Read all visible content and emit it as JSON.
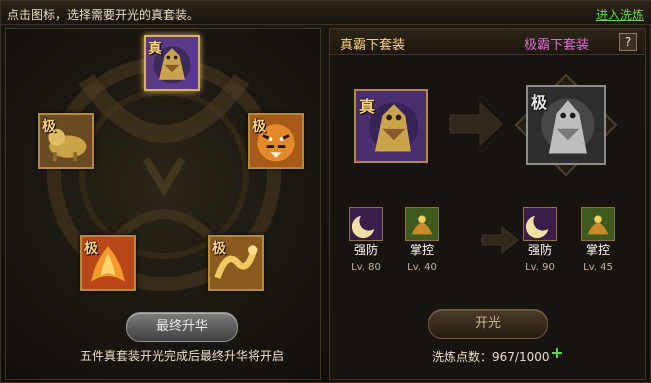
{
  "topbar": {
    "tip": "点击图标，选择需要开光的真套装。",
    "link": "进入洗炼"
  },
  "left_panel": {
    "slots": [
      {
        "badge": "真",
        "icon": "dragon-beast-icon",
        "selected": true
      },
      {
        "badge": "极",
        "icon": "qilin-icon",
        "selected": false
      },
      {
        "badge": "极",
        "icon": "tiger-icon",
        "selected": false
      },
      {
        "badge": "极",
        "icon": "phoenix-icon",
        "selected": false
      },
      {
        "badge": "极",
        "icon": "golden-dragon-icon",
        "selected": false
      }
    ],
    "button": "最终升华",
    "note": "五件真套装开光完成后最终升华将开启"
  },
  "right_panel": {
    "current_title": "真霸下套装",
    "next_title": "极霸下套装",
    "help": "?",
    "current_badge": "真",
    "next_badge": "极",
    "skills_current": [
      {
        "name": "强防",
        "level": "Lv. 80"
      },
      {
        "name": "掌控",
        "level": "Lv. 40"
      }
    ],
    "skills_next": [
      {
        "name": "强防",
        "level": "Lv. 90"
      },
      {
        "name": "掌控",
        "level": "Lv. 45"
      }
    ],
    "button": "开光",
    "points_text": "洗炼点数：967/1000",
    "plus": "+"
  },
  "colors": {
    "gold": "#ffd27a",
    "purple": "#e06bd7",
    "green": "#6bd64b"
  }
}
